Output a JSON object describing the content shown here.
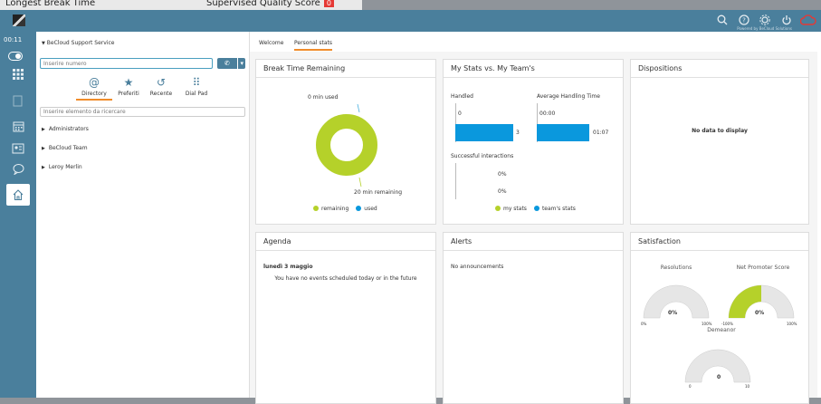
{
  "background_window": {
    "item1": "Longest Break Time",
    "item2": "Supervised Quality Score",
    "item2_badge": "0"
  },
  "topbar": {
    "powered_by": "Powered by BeCloud Solutions",
    "icons": [
      "search-icon",
      "help-icon",
      "settings-icon",
      "power-icon",
      "cloud-icon"
    ]
  },
  "rail": {
    "timer": "00:11",
    "items": [
      "toggle",
      "dialpad-grid-icon",
      "document-icon",
      "calendar-icon",
      "contact-card-icon",
      "chat-icon",
      "home-icon"
    ]
  },
  "left_panel": {
    "service": "BeCloud Support Service",
    "number_placeholder": "Inserire numero",
    "tabs": [
      {
        "label": "Directory",
        "icon": "@"
      },
      {
        "label": "Preferiti",
        "icon": "★"
      },
      {
        "label": "Recente",
        "icon": "↺"
      },
      {
        "label": "Dial Pad",
        "icon": "⠿"
      }
    ],
    "tree_placeholder": "Inserire elemento da ricercare",
    "tree_items": [
      "Administrators",
      "BeCloud Team",
      "Leroy Merlin"
    ]
  },
  "main": {
    "tabs": [
      "Welcome",
      "Personal stats"
    ],
    "break_time": {
      "title": "Break Time Remaining",
      "used_label": "0 min used",
      "remaining_label": "20 min remaining",
      "remaining_fraction": 1.0,
      "legend": [
        "remaining",
        "used"
      ]
    },
    "my_stats": {
      "title": "My Stats vs. My Team's",
      "handled": {
        "label": "Handled",
        "my": "0",
        "team": "3"
      },
      "aht": {
        "label": "Average Handling Time",
        "my": "00:00",
        "team": "01:07"
      },
      "successful": {
        "label": "Successful interactions",
        "my": "0%",
        "team": "0%"
      },
      "legend": [
        "my stats",
        "team's stats"
      ]
    },
    "dispositions": {
      "title": "Dispositions",
      "empty": "No data to display"
    },
    "agenda": {
      "title": "Agenda",
      "date": "lunedì 3 maggio",
      "message": "You have no events scheduled today or in the future"
    },
    "alerts": {
      "title": "Alerts",
      "message": "No announcements"
    },
    "satisfaction": {
      "title": "Satisfaction",
      "resolutions": {
        "label": "Resolutions",
        "value": "0%",
        "min": "0%",
        "max": "100%",
        "fraction": 0
      },
      "nps": {
        "label": "Net Promoter Score",
        "value": "0%",
        "min": "-100%",
        "max": "100%",
        "fraction": 0.5
      },
      "demeanor": {
        "label": "Demeanor",
        "value": "0",
        "min": "0",
        "max": "10",
        "fraction": 0
      }
    }
  },
  "colors": {
    "accent": "#4a7f9c",
    "green": "#b5d12a",
    "blue": "#0a98dd",
    "orange": "#f08c2a",
    "red": "#e53935"
  }
}
